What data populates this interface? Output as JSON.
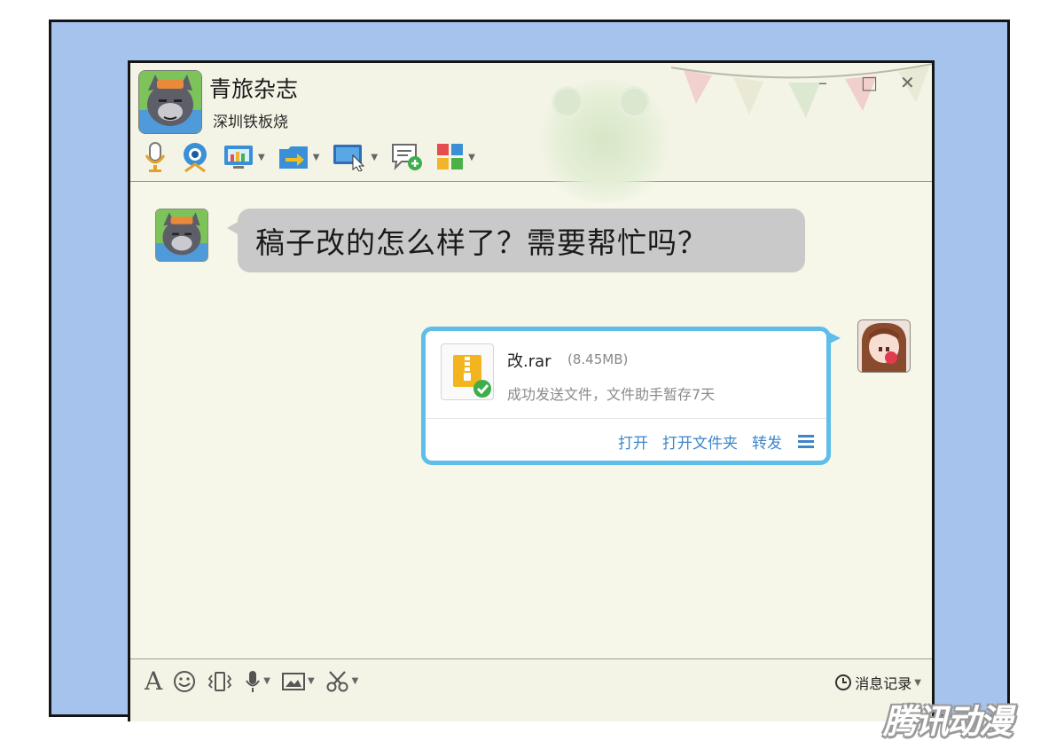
{
  "window": {
    "title": "青旅杂志",
    "subtitle": "深圳铁板烧",
    "controls": {
      "minimize": "–",
      "maximize": "□",
      "close": "✕"
    }
  },
  "toolbar": {
    "icons": [
      "microphone-icon",
      "webcam-icon",
      "screen-share-icon",
      "file-transfer-icon",
      "remote-desktop-icon",
      "add-chat-icon",
      "apps-icon"
    ]
  },
  "messages": {
    "incoming": {
      "text": "稿子改的怎么样了？需要帮忙吗？"
    },
    "outgoing_file": {
      "name": "改.rar",
      "size": "(8.45MB)",
      "status": "成功发送文件，文件助手暂存7天",
      "actions": {
        "open": "打开",
        "open_folder": "打开文件夹",
        "forward": "转发"
      }
    }
  },
  "inputbar": {
    "font_glyph": "A",
    "history_label": "消息记录"
  },
  "watermark": "腾讯动漫",
  "colors": {
    "panel_bg": "#a6c3ee",
    "accent": "#5fbdea",
    "link": "#3d86c9"
  }
}
